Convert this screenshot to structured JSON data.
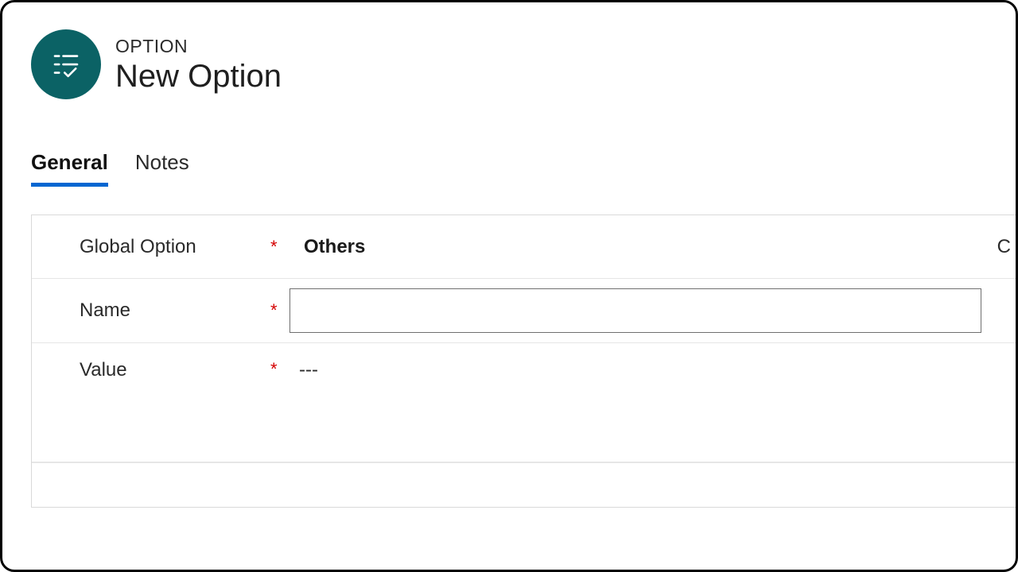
{
  "header": {
    "entity_type": "OPTION",
    "title": "New Option"
  },
  "tabs": [
    {
      "label": "General",
      "active": true
    },
    {
      "label": "Notes",
      "active": false
    }
  ],
  "form": {
    "global_option": {
      "label": "Global Option",
      "required": "*",
      "value": "Others"
    },
    "name": {
      "label": "Name",
      "required": "*",
      "value": ""
    },
    "value": {
      "label": "Value",
      "required": "*",
      "display": "---"
    }
  }
}
